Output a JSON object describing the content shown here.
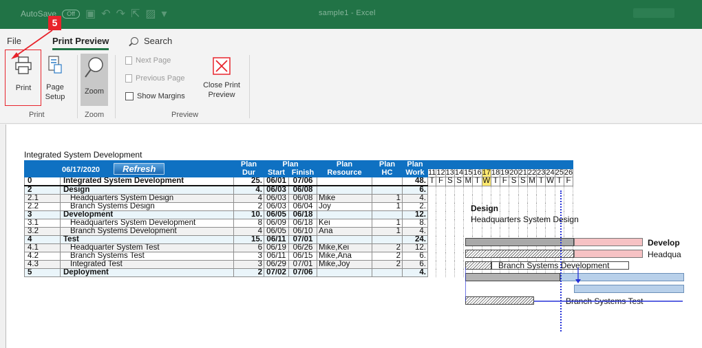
{
  "titlebar": {
    "autosave": "AutoSave",
    "toggle": "Off",
    "filename": "sample1 - Excel"
  },
  "step": {
    "number": "5"
  },
  "tabs": {
    "file": "File",
    "print_preview": "Print Preview",
    "search": "Search"
  },
  "ribbon": {
    "print": "Print",
    "page_setup_1": "Page",
    "page_setup_2": "Setup",
    "zoom": "Zoom",
    "next_page": "Next Page",
    "previous_page": "Previous Page",
    "show_margins": "Show Margins",
    "close_print_1": "Close Print",
    "close_print_2": "Preview",
    "group_print": "Print",
    "group_zoom": "Zoom",
    "group_preview": "Preview"
  },
  "report": {
    "title": "Integrated System Development",
    "date": "06/17/2020",
    "refresh": "Refresh",
    "headers": {
      "plan_dur_1": "Plan",
      "plan_dur_2": "Dur",
      "plan_1": "Plan",
      "start": "Start",
      "finish": "Finish",
      "plan_res_1": "Plan",
      "plan_res_2": "Resource",
      "plan_hc_1": "Plan",
      "plan_hc_2": "HC",
      "plan_work_1": "Plan",
      "plan_work_2": "Work"
    },
    "days": [
      "11",
      "12",
      "13",
      "14",
      "15",
      "16",
      "17",
      "18",
      "19",
      "20",
      "21",
      "22",
      "23",
      "24",
      "25",
      "26"
    ],
    "weekdays": [
      "T",
      "F",
      "S",
      "S",
      "M",
      "T",
      "W",
      "T",
      "F",
      "S",
      "S",
      "M",
      "T",
      "W",
      "T",
      "F"
    ],
    "rows": [
      {
        "id": "0",
        "name": "Integrated System Development",
        "dur": "25.",
        "start": "06/01",
        "finish": "07/06",
        "res": "",
        "hc": "",
        "work": "48."
      },
      {
        "id": "2",
        "name": "Design",
        "dur": "4.",
        "start": "06/03",
        "finish": "06/08",
        "res": "",
        "hc": "",
        "work": "6."
      },
      {
        "id": "2.1",
        "name": "Headquarters System Design",
        "dur": "4",
        "start": "06/03",
        "finish": "06/08",
        "res": "Mike",
        "hc": "1",
        "work": "4."
      },
      {
        "id": "2.2",
        "name": "Branch Systems Design",
        "dur": "2",
        "start": "06/03",
        "finish": "06/04",
        "res": "Joy",
        "hc": "1",
        "work": "2."
      },
      {
        "id": "3",
        "name": "Development",
        "dur": "10.",
        "start": "06/05",
        "finish": "06/18",
        "res": "",
        "hc": "",
        "work": "12."
      },
      {
        "id": "3.1",
        "name": "Headquarters System Development",
        "dur": "8",
        "start": "06/09",
        "finish": "06/18",
        "res": "Kei",
        "hc": "1",
        "work": "8."
      },
      {
        "id": "3.2",
        "name": "Branch Systems Development",
        "dur": "4",
        "start": "06/05",
        "finish": "06/10",
        "res": "Ana",
        "hc": "1",
        "work": "4."
      },
      {
        "id": "4",
        "name": "Test",
        "dur": "15.",
        "start": "06/11",
        "finish": "07/01",
        "res": "",
        "hc": "",
        "work": "24."
      },
      {
        "id": "4.1",
        "name": "Headquarter System Test",
        "dur": "6",
        "start": "06/19",
        "finish": "06/26",
        "res": "Mike,Kei",
        "hc": "2",
        "work": "12."
      },
      {
        "id": "4.2",
        "name": "Branch Systems Test",
        "dur": "3",
        "start": "06/11",
        "finish": "06/15",
        "res": "Mike,Ana",
        "hc": "2",
        "work": "6."
      },
      {
        "id": "4.3",
        "name": "Integrated Test",
        "dur": "3",
        "start": "06/29",
        "finish": "07/01",
        "res": "Mike,Joy",
        "hc": "2",
        "work": "6."
      },
      {
        "id": "5",
        "name": "Deployment",
        "dur": "2",
        "start": "07/02",
        "finish": "07/06",
        "res": "",
        "hc": "",
        "work": "4."
      }
    ],
    "gantt_labels": {
      "design": "Design",
      "hq_design": "Headquarters System Design",
      "develop": "Develop",
      "headqua": "Headqua",
      "branch_dev": "Branch Systems Development",
      "branch_test": "Branch Systems Test"
    }
  },
  "colors": {
    "excel_green": "#217346",
    "header_blue": "#0f71c2",
    "highlight_red": "#e8242c",
    "today_yellow": "#ffe970"
  }
}
